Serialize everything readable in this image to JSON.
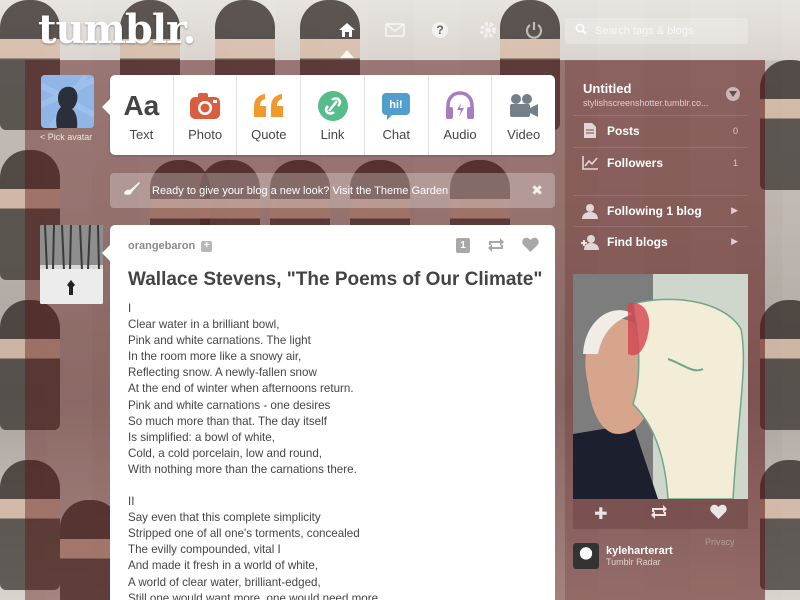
{
  "header": {
    "logo": "tumblr.",
    "search": {
      "placeholder": "Search tags & blogs"
    }
  },
  "avatar": {
    "pick_label": "< Pick avatar"
  },
  "composer": {
    "types": [
      {
        "label": "Text",
        "icon": "text-icon",
        "color": "#444444"
      },
      {
        "label": "Photo",
        "icon": "camera-icon",
        "color": "#d95e40"
      },
      {
        "label": "Quote",
        "icon": "quote-icon",
        "color": "#f2992e"
      },
      {
        "label": "Link",
        "icon": "link-icon",
        "color": "#56bc8a"
      },
      {
        "label": "Chat",
        "icon": "chat-icon",
        "color": "#529ecc"
      },
      {
        "label": "Audio",
        "icon": "headphones-icon",
        "color": "#a77dc2"
      },
      {
        "label": "Video",
        "icon": "video-camera-icon",
        "color": "#748089"
      }
    ]
  },
  "notice": {
    "text": "Ready to give your blog a new look? Visit the Theme Garden"
  },
  "post": {
    "username": "orangebaron",
    "note_count": "1",
    "title": "Wallace Stevens, \"The Poems of Our Climate\"",
    "stanzas": [
      "I\nClear water in a brilliant bowl,\nPink and white carnations. The light\nIn the room more like a snowy air,\nReflecting snow. A newly-fallen snow\nAt the end of winter when afternoons return.\nPink and white carnations - one desires\nSo much more than that. The day itself\nIs simplified: a bowl of white,\nCold, a cold porcelain, low and round,\nWith nothing more than the carnations there.",
      "II\nSay even that this complete simplicity\nStripped one of all one's torments, concealed\nThe evilly compounded, vital I\nAnd made it fresh in a world of white,\nA world of clear water, brilliant-edged,\nStill one would want more, one would need more"
    ]
  },
  "sidebar": {
    "blog_name": "Untitled",
    "blog_url": "stylishscreenshotter.tumblr.co...",
    "posts_label": "Posts",
    "posts_count": "0",
    "followers_label": "Followers",
    "followers_count": "1",
    "following_label": "Following 1 blog",
    "find_label": "Find blogs",
    "radar_user": "kyleharterart",
    "radar_label": "Tumblr Radar",
    "privacy": "Privacy"
  }
}
